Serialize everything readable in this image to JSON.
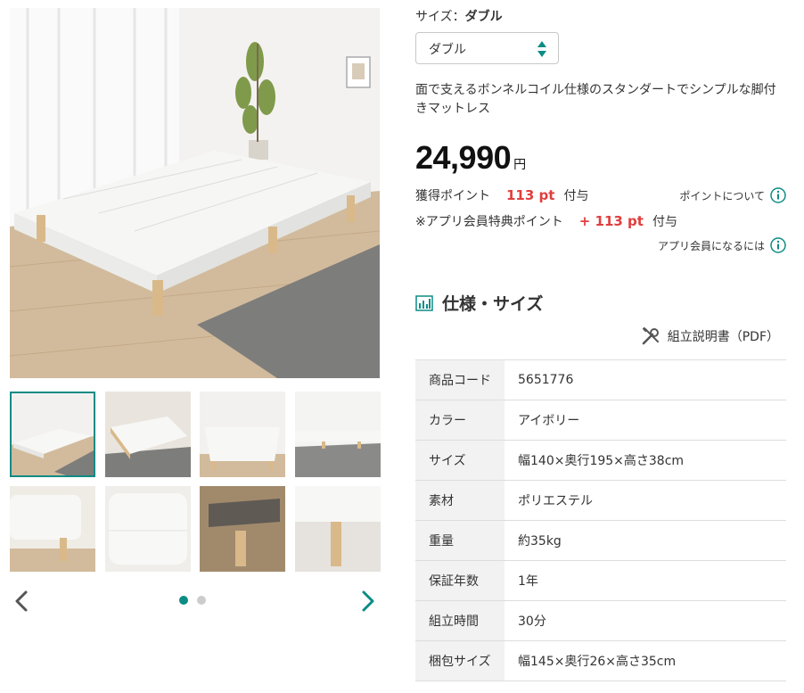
{
  "gallery": {
    "thumbnail_count": 8,
    "active_thumbnail": 1,
    "page_dots": 2,
    "active_dot": 1
  },
  "size": {
    "label": "サイズ：",
    "value": "ダブル",
    "select_value": "ダブル"
  },
  "description": "面で支えるボンネルコイル仕様のスタンダートでシンプルな脚付きマットレス",
  "price": {
    "amount": "24,990",
    "currency": "円"
  },
  "points": {
    "earned_label": "獲得ポイント",
    "earned_value": "113 pt",
    "earned_suffix": "付与",
    "about_link": "ポイントについて",
    "app_label": "※アプリ会員特典ポイント",
    "app_value": "+ 113 pt",
    "app_suffix": "付与",
    "app_link": "アプリ会員になるには"
  },
  "spec": {
    "title": "仕様・サイズ",
    "pdf_link": "組立説明書（PDF）",
    "rows": [
      {
        "label": "商品コード",
        "value": "5651776"
      },
      {
        "label": "カラー",
        "value": "アイボリー"
      },
      {
        "label": "サイズ",
        "value": "幅140×奥行195×高さ38cm"
      },
      {
        "label": "素材",
        "value": "ポリエステル"
      },
      {
        "label": "重量",
        "value": "約35kg"
      },
      {
        "label": "保証年数",
        "value": "1年"
      },
      {
        "label": "組立時間",
        "value": "30分"
      },
      {
        "label": "梱包サイズ",
        "value": "幅145×奥行26×高さ35cm"
      }
    ]
  },
  "colors": {
    "accent": "#0c8c85",
    "points_red": "#e03e3e"
  },
  "icons": {
    "prev": "chevron-left-icon",
    "next": "chevron-right-icon",
    "info": "info-circle-icon",
    "spec": "chart-icon",
    "tools": "tools-icon",
    "select": "up-down-arrows-icon"
  }
}
